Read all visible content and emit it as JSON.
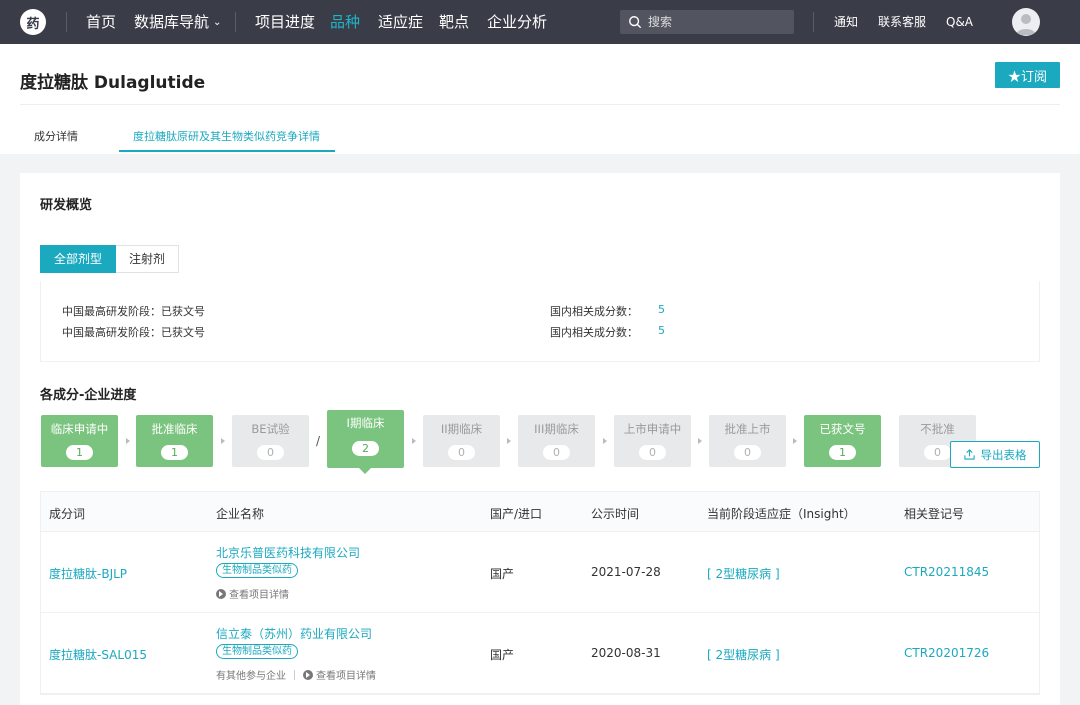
{
  "nav": {
    "logo_text": "药",
    "items": [
      {
        "label": "首页",
        "active": false
      },
      {
        "label": "数据库导航",
        "active": false,
        "has_dropdown": true
      },
      {
        "label": "项目进度",
        "active": false
      },
      {
        "label": "品种",
        "active": true
      },
      {
        "label": "适应症",
        "active": false
      },
      {
        "label": "靶点",
        "active": false
      },
      {
        "label": "企业分析",
        "active": false
      }
    ],
    "search_placeholder": "搜索",
    "right_links": [
      "通知",
      "联系客服",
      "Q&A"
    ]
  },
  "page": {
    "title": "度拉糖肽 Dulaglutide",
    "subscribe_label": "★订阅",
    "tabs": [
      {
        "label": "成分详情",
        "active": false
      },
      {
        "label": "度拉糖肽原研及其生物类似药竞争详情",
        "active": true
      }
    ]
  },
  "overview": {
    "title": "研发概览",
    "segments": [
      {
        "label": "全部剂型",
        "active": true
      },
      {
        "label": "注射剂",
        "active": false
      }
    ],
    "rows": [
      {
        "left_label": "中国最高研发阶段：",
        "left_value": "已获文号",
        "right_label": "国内相关成分数：",
        "right_value": "5"
      },
      {
        "left_label": "中国最高研发阶段：",
        "left_value": "已获文号",
        "right_label": "国内相关成分数：",
        "right_value": "5"
      }
    ]
  },
  "progress": {
    "title": "各成分-企业进度",
    "stages": [
      {
        "label": "临床申请中",
        "count": "1",
        "active": true
      },
      {
        "label": "批准临床",
        "count": "1",
        "active": true
      },
      {
        "label": "BE试验",
        "count": "0",
        "active": false
      },
      {
        "label": "I期临床",
        "count": "2",
        "active": true,
        "selected": true
      },
      {
        "label": "II期临床",
        "count": "0",
        "active": false
      },
      {
        "label": "III期临床",
        "count": "0",
        "active": false
      },
      {
        "label": "上市申请中",
        "count": "0",
        "active": false
      },
      {
        "label": "批准上市",
        "count": "0",
        "active": false
      },
      {
        "label": "已获文号",
        "count": "1",
        "active": true
      },
      {
        "label": "不批准",
        "count": "0",
        "active": false
      }
    ],
    "slash": "/",
    "export_label": "导出表格"
  },
  "table": {
    "headers": [
      "成分词",
      "企业名称",
      "国产/进口",
      "公示时间",
      "当前阶段适应症（Insight）",
      "相关登记号"
    ],
    "rows": [
      {
        "ingredient": "度拉糖肽-BJLP",
        "company": "北京乐普医药科技有限公司",
        "tag": "生物制品类似药",
        "extra": "",
        "detail": "查看项目详情",
        "origin": "国产",
        "date": "2021-07-28",
        "indication": "[ 2型糖尿病 ]",
        "reg_no": "CTR20211845"
      },
      {
        "ingredient": "度拉糖肽-SAL015",
        "company": "信立泰（苏州）药业有限公司",
        "tag": "生物制品类似药",
        "extra": "有其他参与企业",
        "detail": "查看项目详情",
        "origin": "国产",
        "date": "2020-08-31",
        "indication": "[ 2型糖尿病 ]",
        "reg_no": "CTR20201726"
      }
    ]
  }
}
